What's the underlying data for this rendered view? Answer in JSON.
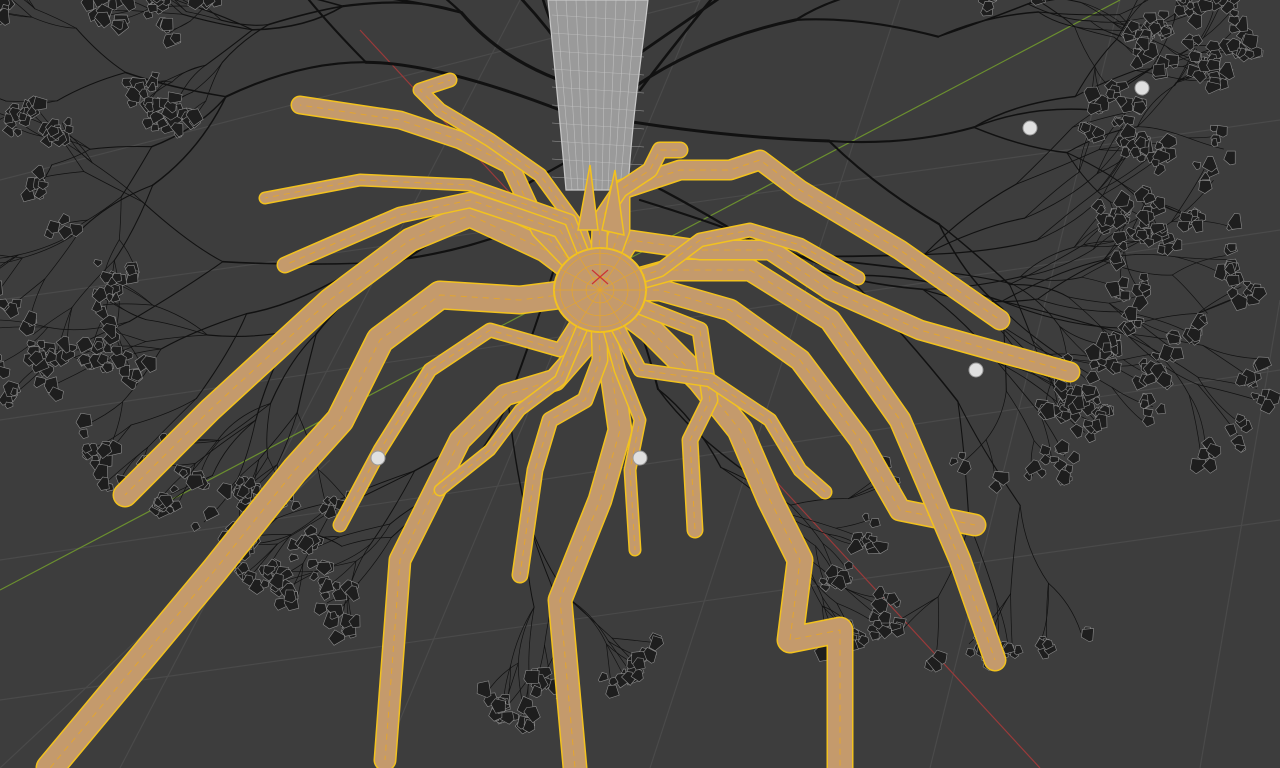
{
  "viewport": {
    "mode": "edit-mode-wireframe-overlay",
    "colors": {
      "background": "#3d3d3d",
      "grid_line": "#4a4a4a",
      "axis_x": "#9a3a3a",
      "axis_y": "#6b8f2f",
      "trunk_fill": "#9a9a9a",
      "trunk_wire": "#c8c8c8",
      "branch_wire": "#111111",
      "leaf_cluster": "#1e1e1e",
      "leaf_wire": "#8c8c8c",
      "root_fill": "#c49a6c",
      "root_edge": "#f2c21e",
      "root_wire": "#e6a62a",
      "origin_dot": "#e0e0e0"
    }
  }
}
